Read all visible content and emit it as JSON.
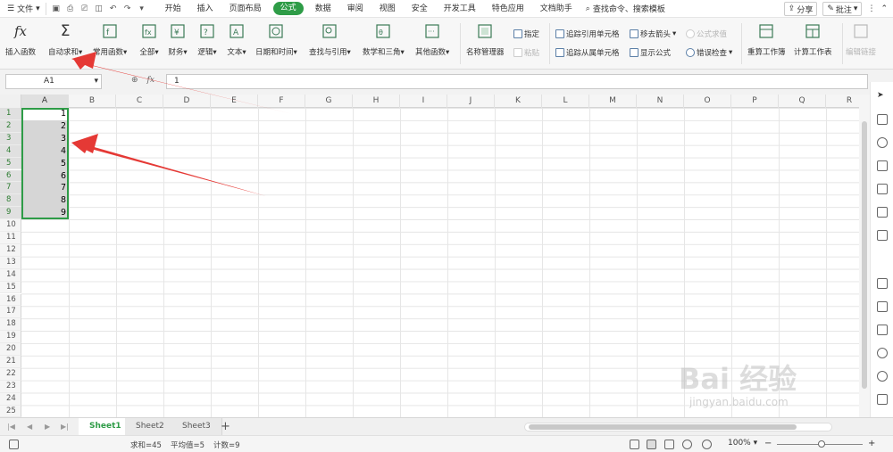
{
  "menubar": {
    "file_label": "文件",
    "tabs": [
      "开始",
      "插入",
      "页面布局",
      "公式",
      "数据",
      "审阅",
      "视图",
      "安全",
      "开发工具",
      "特色应用",
      "文档助手"
    ],
    "active_tab": "公式",
    "search_label": "查找命令、搜索模板",
    "share_label": "分享",
    "comment_label": "批注"
  },
  "ribbon": {
    "insert_function": "插入函数",
    "autosum": "自动求和",
    "common_functions": "常用函数",
    "all": "全部",
    "finance": "财务",
    "logic": "逻辑",
    "text": "文本",
    "datetime": "日期和时间",
    "lookup": "查找与引用",
    "math": "数学和三角",
    "other": "其他函数",
    "name_manager": "名称管理器",
    "specify": "指定",
    "paste": "粘贴",
    "trace_precedents": "追踪引用单元格",
    "trace_dependents": "追踪从属单元格",
    "remove_arrows": "移去箭头",
    "show_formulas": "显示公式",
    "formula_evaluate": "公式求值",
    "error_check": "错误检查",
    "recalc_workbook": "重算工作簿",
    "calc_sheet": "计算工作表",
    "edit_links": "编辑链接"
  },
  "formula_bar": {
    "name_box": "A1",
    "fx": "fx",
    "value": "1"
  },
  "grid": {
    "columns": [
      "A",
      "B",
      "C",
      "D",
      "E",
      "F",
      "G",
      "H",
      "I",
      "J",
      "K",
      "L",
      "M",
      "N",
      "O",
      "P",
      "Q",
      "R"
    ],
    "rows": [
      "1",
      "2",
      "3",
      "4",
      "5",
      "6",
      "7",
      "8",
      "9",
      "10",
      "11",
      "12",
      "13",
      "14",
      "15",
      "16",
      "17",
      "18",
      "19",
      "20",
      "21",
      "22",
      "23",
      "24",
      "25"
    ],
    "a_values": [
      "1",
      "2",
      "3",
      "4",
      "5",
      "6",
      "7",
      "8",
      "9"
    ]
  },
  "sheets": {
    "tabs": [
      "Sheet1",
      "Sheet2",
      "Sheet3"
    ],
    "active": "Sheet1"
  },
  "status": {
    "sum": "求和=45",
    "avg": "平均值=5",
    "count": "计数=9",
    "zoom": "100%"
  },
  "watermark": {
    "text": "Bai 经验",
    "url": "jingyan.baidu.com"
  },
  "colors": {
    "accent": "#2e9c47",
    "arrow": "#e53935",
    "selection_fill": "#d6d6d6"
  }
}
